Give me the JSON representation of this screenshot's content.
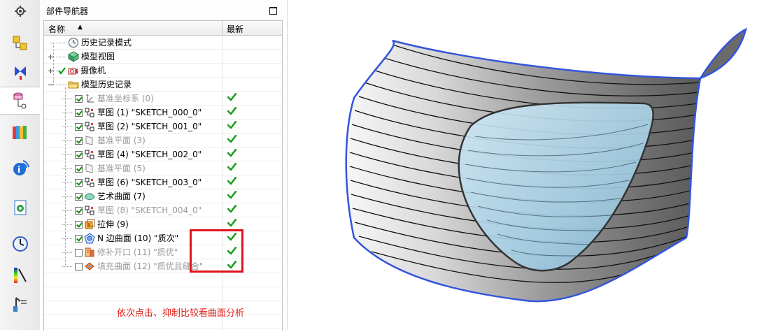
{
  "navigator": {
    "title": "部件导航器",
    "columns": {
      "name": "名称",
      "sort": "▲",
      "latest": "最新"
    }
  },
  "tree": [
    {
      "label": "历史记录模式",
      "indent": 0,
      "icon": "clock-icon",
      "kind": "plain",
      "checked": null,
      "dim": false,
      "latest": false
    },
    {
      "label": "模型视图",
      "indent": 0,
      "icon": "model-views-icon",
      "kind": "expand",
      "checked": null,
      "dim": false,
      "latest": false
    },
    {
      "label": "摄像机",
      "indent": 0,
      "icon": "camera-icon",
      "kind": "expand-check",
      "checked": null,
      "dim": false,
      "latest": false
    },
    {
      "label": "模型历史记录",
      "indent": 0,
      "icon": "folder-icon",
      "kind": "collapse",
      "checked": null,
      "dim": false,
      "latest": false
    },
    {
      "label": "基准坐标系 (0)",
      "indent": 1,
      "icon": "datum-csys-icon",
      "checked": true,
      "dim": true,
      "latest": true
    },
    {
      "label": "草图 (1) \"SKETCH_000_0\"",
      "indent": 1,
      "icon": "sketch-icon",
      "checked": true,
      "dim": false,
      "latest": true
    },
    {
      "label": "草图 (2) \"SKETCH_001_0\"",
      "indent": 1,
      "icon": "sketch-icon",
      "checked": true,
      "dim": false,
      "latest": true
    },
    {
      "label": "基准平面 (3)",
      "indent": 1,
      "icon": "datum-plane-icon",
      "checked": true,
      "dim": true,
      "latest": true
    },
    {
      "label": "草图 (4) \"SKETCH_002_0\"",
      "indent": 1,
      "icon": "sketch-icon",
      "checked": true,
      "dim": false,
      "latest": true
    },
    {
      "label": "基准平面 (5)",
      "indent": 1,
      "icon": "datum-plane-icon",
      "checked": true,
      "dim": true,
      "latest": true
    },
    {
      "label": "草图 (6) \"SKETCH_003_0\"",
      "indent": 1,
      "icon": "sketch-icon",
      "checked": true,
      "dim": false,
      "latest": true
    },
    {
      "label": "艺术曲面 (7)",
      "indent": 1,
      "icon": "studio-surface-icon",
      "checked": true,
      "dim": false,
      "latest": true
    },
    {
      "label": "草图 (8) \"SKETCH_004_0\"",
      "indent": 1,
      "icon": "sketch-icon",
      "checked": true,
      "dim": true,
      "latest": true
    },
    {
      "label": "拉伸 (9)",
      "indent": 1,
      "icon": "extrude-icon",
      "checked": true,
      "dim": false,
      "latest": true
    },
    {
      "label": "N 边曲面 (10) \"质次\"",
      "indent": 1,
      "icon": "n-sided-surface-icon",
      "checked": true,
      "dim": false,
      "latest": true
    },
    {
      "label": "修补开口 (11) \"质优\"",
      "indent": 1,
      "icon": "patch-openings-icon",
      "checked": false,
      "dim": true,
      "latest": true
    },
    {
      "label": "填充曲面 (12) \"质优且缝合\"",
      "indent": 1,
      "icon": "fill-surface-icon",
      "checked": false,
      "dim": true,
      "latest": true
    }
  ],
  "annotation": "依次点击、抑制比较看曲面分析",
  "resource_bar": [
    {
      "name": "settings-gear-icon"
    },
    {
      "name": "assembly-navigator-icon"
    },
    {
      "name": "constraint-navigator-icon"
    },
    {
      "name": "part-navigator-icon",
      "active": true
    },
    {
      "name": "reuse-library-icon"
    },
    {
      "name": "web-browser-icon"
    },
    {
      "name": "history-palette-icon"
    },
    {
      "name": "clock-icon"
    },
    {
      "name": "visualization-icon"
    },
    {
      "name": "process-studio-icon"
    }
  ],
  "colors": {
    "latest_check": "#1a9e1a",
    "annotation_red": "#e0201c",
    "surface_edge": "#3355dd",
    "patch_fill": "#a9d3e8"
  }
}
